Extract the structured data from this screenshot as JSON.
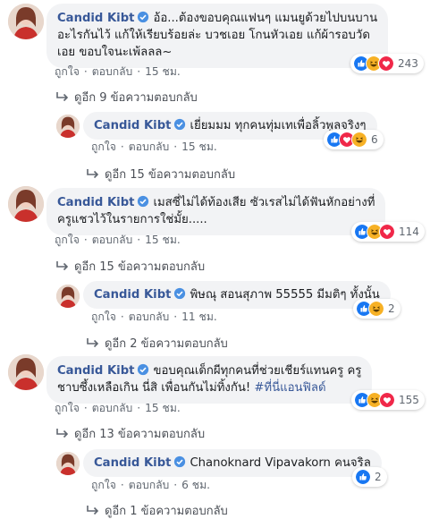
{
  "author": "Candid Kibt",
  "labels": {
    "like": "ถูกใจ",
    "reply": "ตอบกลับ"
  },
  "colors": {
    "name": "#385898",
    "bubble": "#f2f3f5",
    "verified": "#4a90e2"
  },
  "comments": [
    {
      "text_lines": [
        "อ้อ...ต้องขอบคุณแฟนๆ แมนยูด้วยไปบนบาน",
        "อะไรกันไว้ แก้ให้เรียบร้อยล่ะ บวชเอย โกนหัวเอย แก้ผ้ารอบวัด",
        "เอย ขอบใจนะเพ้ลลล~"
      ],
      "time": "15 ชม.",
      "reactions": [
        "like",
        "haha",
        "love"
      ],
      "reaction_count": "243",
      "replies_label": "ดูอีก 9 ข้อความตอบกลับ",
      "reply": {
        "text": "เยี่ยมมม ทุกคนทุ่มเทเพื่อลิ้วพูลจริงๆ",
        "time": "15 ชม.",
        "reactions": [
          "like",
          "love",
          "haha"
        ],
        "reaction_count": "6",
        "replies_label": "ดูอีก 15 ข้อความตอบกลับ"
      }
    },
    {
      "text_lines": [
        "เมสซี่ไม่ได้ท้องเสีย ซัวเรสไม่ได้ฟันหักอย่างที่",
        "ครูแชวไว้ในรายการใช่มั้ย....."
      ],
      "time": "15 ชม.",
      "reactions": [
        "like",
        "haha",
        "love"
      ],
      "reaction_count": "114",
      "replies_label": "ดูอีก 15 ข้อความตอบกลับ",
      "reply": {
        "mention": "พิษณุ สอนสุภาพ",
        "text": " 55555 มีมติๆ ทั้งนั้น",
        "time": "11 ชม.",
        "reactions": [
          "like",
          "haha"
        ],
        "reaction_count": "2",
        "replies_label": "ดูอีก 2 ข้อความตอบกลับ"
      }
    },
    {
      "text_lines": [
        "ขอบคุณเด็กผีทุกคนที่ช่วยเชียร์แทนครู ครู",
        "ชาบซึ้งเหลือเกิน นี่สิ เพื่อนกันไม่ทิ้งกัน! "
      ],
      "hashtag": "#ที่นี่แอนฟิลด์",
      "time": "15 ชม.",
      "reactions": [
        "like",
        "haha",
        "love"
      ],
      "reaction_count": "155",
      "replies_label": "ดูอีก 13 ข้อความตอบกลับ",
      "reply": {
        "mention": "Chanoknard Vipavakorn",
        "text": " คนจริล",
        "time": "6 ชม.",
        "reactions": [
          "like"
        ],
        "reaction_count": "2",
        "replies_label": "ดูอีก 1 ข้อความตอบกลับ"
      }
    }
  ]
}
